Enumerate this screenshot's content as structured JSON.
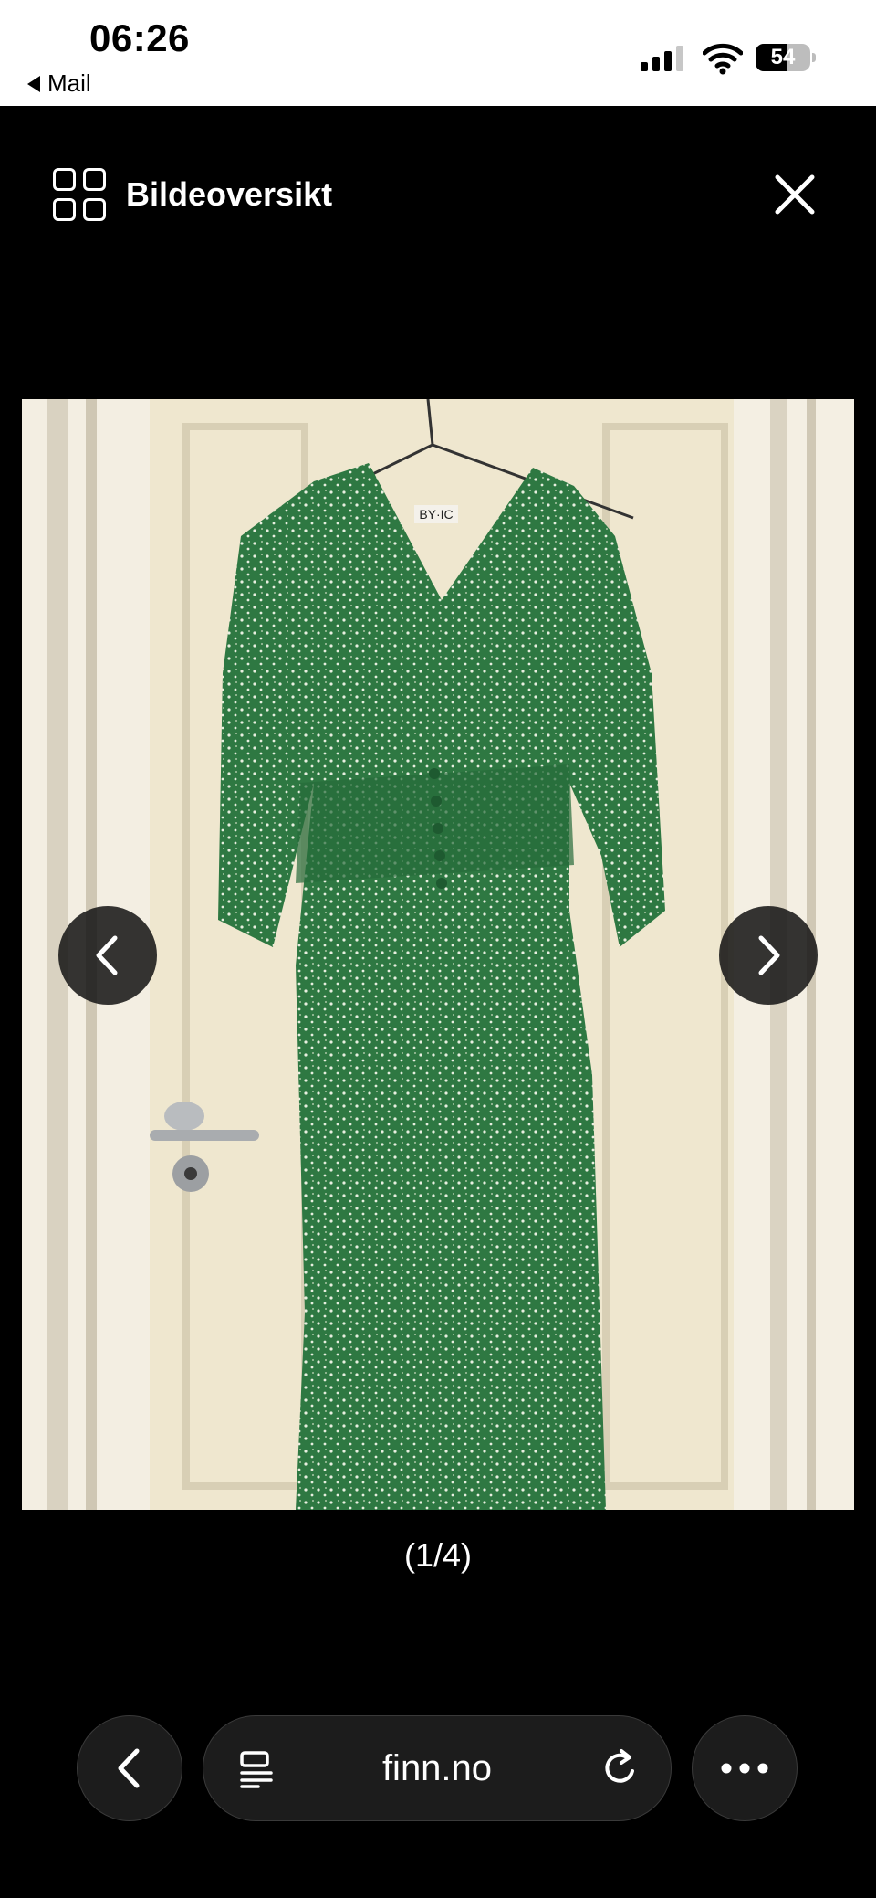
{
  "status_bar": {
    "time": "06:26",
    "back_app": "Mail",
    "battery_percent": "54",
    "signal_bars_active": 3
  },
  "gallery": {
    "overview_label": "Bildeoversikt",
    "counter": "(1/4)",
    "photo_label": "BY·IC"
  },
  "browser": {
    "url": "finn.no"
  },
  "colors": {
    "background": "#000000",
    "dress_green": "#2f7a43",
    "control_bg": "#1c1c1c"
  },
  "icons": {
    "grid": "grid-icon",
    "close": "close-icon",
    "prev": "chevron-left-icon",
    "next": "chevron-right-icon",
    "back": "chevron-left-icon",
    "reader": "reader-mode-icon",
    "reload": "reload-icon",
    "more": "more-icon"
  }
}
